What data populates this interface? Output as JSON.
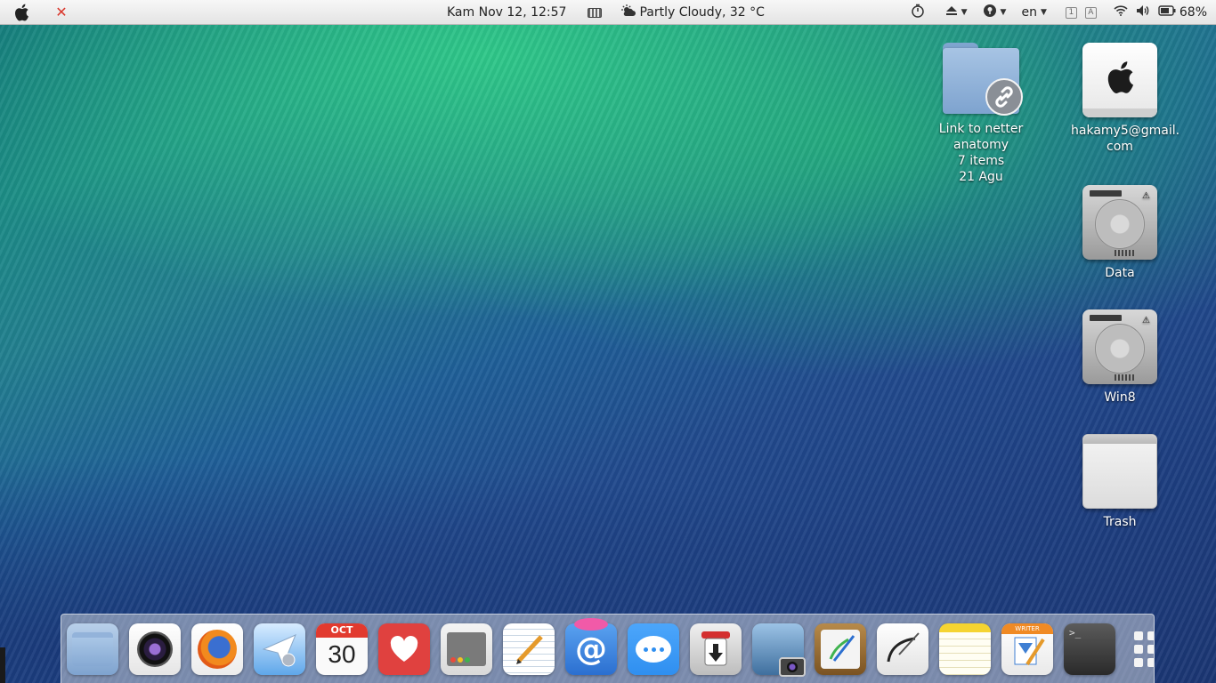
{
  "menubar": {
    "datetime": "Kam Nov 12, 12:57",
    "weather": "Partly Cloudy, 32 °C",
    "language": "en",
    "kbd1": "1",
    "kbdA": "A",
    "battery": "68%"
  },
  "desktop": {
    "icons": [
      {
        "lines": [
          "Link to netter",
          "anatomy",
          "7 items",
          "21 Agu"
        ]
      },
      {
        "lines": [
          "hakamy5@gmail.",
          "com"
        ]
      },
      {
        "lines": [
          "Data"
        ]
      },
      {
        "lines": [
          "Win8"
        ]
      },
      {
        "lines": [
          "Trash"
        ]
      }
    ]
  },
  "dock": {
    "calendar_month": "OCT",
    "calendar_day": "30",
    "writer_label": "WRITER",
    "apps": [
      "files-icon",
      "camera-lens-icon",
      "firefox-icon",
      "mail-send-icon",
      "calendar-icon",
      "heart-icon",
      "window-manager-icon",
      "text-editor-icon",
      "email-at-icon",
      "messages-icon",
      "download-icon",
      "screenshot-icon",
      "drawing-icon",
      "inkscape-icon",
      "notes-icon",
      "writer-icon",
      "terminal-icon",
      "app-grid-icon"
    ]
  },
  "colors": {
    "menubar": "#ececec",
    "close": "#d9372c",
    "folder": "#8fb1d9",
    "heart": "#e0413f",
    "messages": "#2f8ff0"
  }
}
